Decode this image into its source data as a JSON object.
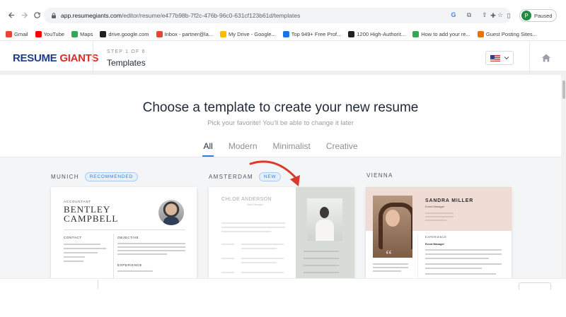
{
  "browser": {
    "url_host": "app.resumegiants.com",
    "url_path": "/editor/resume/e477b98b-7f2c-476b-96c0-631cf123b61d/templates",
    "profile_initial": "P",
    "profile_status": "Paused",
    "bookmarks": [
      {
        "label": "Gmail",
        "color": "#ea4335"
      },
      {
        "label": "YouTube",
        "color": "#ff0000"
      },
      {
        "label": "Maps",
        "color": "#34a853"
      },
      {
        "label": "drive.google.com",
        "color": "#202124"
      },
      {
        "label": "Inbox - partner@la...",
        "color": "#ea4335"
      },
      {
        "label": "My Drive - Google...",
        "color": "#fbbc04"
      },
      {
        "label": "Top 949+ Free Prof...",
        "color": "#1a73e8"
      },
      {
        "label": "1200 High-Authorit...",
        "color": "#202124"
      },
      {
        "label": "How to add your re...",
        "color": "#34a853"
      },
      {
        "label": "Guest Posting Sites...",
        "color": "#e8710a"
      }
    ]
  },
  "header": {
    "logo_part1": "RESUME",
    "logo_part2": "GIANTS",
    "step": "STEP 1 OF 6",
    "title": "Templates"
  },
  "hero": {
    "title": "Choose a template to create your new resume",
    "subtitle": "Pick your favorite! You'll be able to change it later",
    "tabs": [
      "All",
      "Modern",
      "Minimalist",
      "Creative"
    ],
    "active_tab": "All"
  },
  "templates": [
    {
      "name": "MUNICH",
      "badge": "RECOMMENDED",
      "preview": {
        "role": "ACCOUNTANT",
        "first": "BENTLEY",
        "last": "CAMPBELL",
        "contact": "CONTACT",
        "objective": "OBJECTIVE",
        "experience": "EXPERIENCE"
      }
    },
    {
      "name": "AMSTERDAM",
      "badge": "NEW",
      "preview": {
        "name": "CHLOE ANDERSON",
        "role": "Store Manager"
      }
    },
    {
      "name": "VIENNA",
      "badge": "",
      "preview": {
        "name": "SANDRA MILLER",
        "role": "Event Manager",
        "section": "EXPERIENCE",
        "job": "Event Manager"
      }
    }
  ],
  "colors": {
    "accent": "#2b7de9",
    "logo_blue": "#1c3d8b",
    "logo_red": "#e02b2b",
    "arrow": "#d93a2b"
  }
}
